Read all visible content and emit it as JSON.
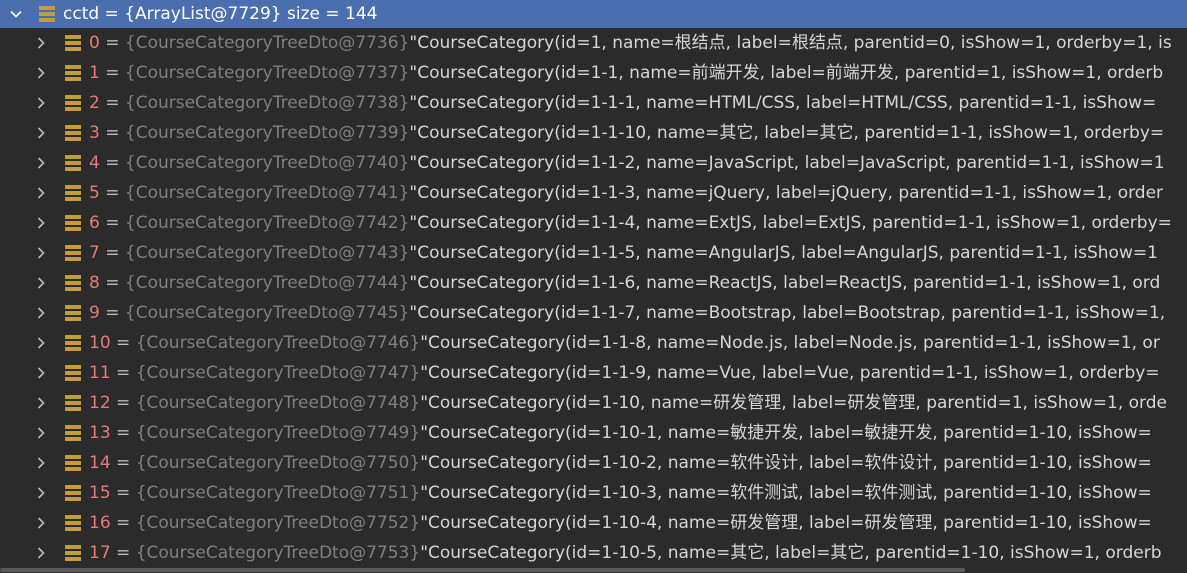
{
  "header": {
    "name": "cctd",
    "eq": " = ",
    "type": "{ArrayList@7729}",
    "size_text": "  size = 144"
  },
  "items": [
    {
      "index": "0",
      "ref": "{CourseCategoryTreeDto@7736}",
      "value": "\"CourseCategory(id=1, name=根结点, label=根结点, parentid=0, isShow=1, orderby=1, is"
    },
    {
      "index": "1",
      "ref": "{CourseCategoryTreeDto@7737}",
      "value": "\"CourseCategory(id=1-1, name=前端开发, label=前端开发, parentid=1, isShow=1, orderb"
    },
    {
      "index": "2",
      "ref": "{CourseCategoryTreeDto@7738}",
      "value": "\"CourseCategory(id=1-1-1, name=HTML/CSS, label=HTML/CSS, parentid=1-1, isShow="
    },
    {
      "index": "3",
      "ref": "{CourseCategoryTreeDto@7739}",
      "value": "\"CourseCategory(id=1-1-10, name=其它, label=其它, parentid=1-1, isShow=1, orderby="
    },
    {
      "index": "4",
      "ref": "{CourseCategoryTreeDto@7740}",
      "value": "\"CourseCategory(id=1-1-2, name=JavaScript, label=JavaScript, parentid=1-1, isShow=1"
    },
    {
      "index": "5",
      "ref": "{CourseCategoryTreeDto@7741}",
      "value": "\"CourseCategory(id=1-1-3, name=jQuery, label=jQuery, parentid=1-1, isShow=1, order"
    },
    {
      "index": "6",
      "ref": "{CourseCategoryTreeDto@7742}",
      "value": "\"CourseCategory(id=1-1-4, name=ExtJS, label=ExtJS, parentid=1-1, isShow=1, orderby="
    },
    {
      "index": "7",
      "ref": "{CourseCategoryTreeDto@7743}",
      "value": "\"CourseCategory(id=1-1-5, name=AngularJS, label=AngularJS, parentid=1-1, isShow=1"
    },
    {
      "index": "8",
      "ref": "{CourseCategoryTreeDto@7744}",
      "value": "\"CourseCategory(id=1-1-6, name=ReactJS, label=ReactJS, parentid=1-1, isShow=1, ord"
    },
    {
      "index": "9",
      "ref": "{CourseCategoryTreeDto@7745}",
      "value": "\"CourseCategory(id=1-1-7, name=Bootstrap, label=Bootstrap, parentid=1-1, isShow=1,"
    },
    {
      "index": "10",
      "ref": "{CourseCategoryTreeDto@7746}",
      "value": "\"CourseCategory(id=1-1-8, name=Node.js, label=Node.js, parentid=1-1, isShow=1, or"
    },
    {
      "index": "11",
      "ref": "{CourseCategoryTreeDto@7747}",
      "value": "\"CourseCategory(id=1-1-9, name=Vue, label=Vue, parentid=1-1, isShow=1, orderby="
    },
    {
      "index": "12",
      "ref": "{CourseCategoryTreeDto@7748}",
      "value": "\"CourseCategory(id=1-10, name=研发管理, label=研发管理, parentid=1, isShow=1, orde"
    },
    {
      "index": "13",
      "ref": "{CourseCategoryTreeDto@7749}",
      "value": "\"CourseCategory(id=1-10-1, name=敏捷开发, label=敏捷开发, parentid=1-10, isShow="
    },
    {
      "index": "14",
      "ref": "{CourseCategoryTreeDto@7750}",
      "value": "\"CourseCategory(id=1-10-2, name=软件设计, label=软件设计, parentid=1-10, isShow="
    },
    {
      "index": "15",
      "ref": "{CourseCategoryTreeDto@7751}",
      "value": "\"CourseCategory(id=1-10-3, name=软件测试, label=软件测试, parentid=1-10, isShow="
    },
    {
      "index": "16",
      "ref": "{CourseCategoryTreeDto@7752}",
      "value": "\"CourseCategory(id=1-10-4, name=研发管理, label=研发管理, parentid=1-10, isShow="
    },
    {
      "index": "17",
      "ref": "{CourseCategoryTreeDto@7753}",
      "value": "\"CourseCategory(id=1-10-5, name=其它, label=其它, parentid=1-10, isShow=1, orderb"
    }
  ],
  "icons": {
    "expanded": "chevron-down-icon",
    "collapsed": "chevron-right-icon",
    "field": "field-icon"
  },
  "colors": {
    "selection": "#4b6eaf",
    "background": "#2b2b2b",
    "index": "#e87b78",
    "type_ref": "#808080",
    "value": "#d6d6d6",
    "field_icon": "#c39d3a"
  }
}
